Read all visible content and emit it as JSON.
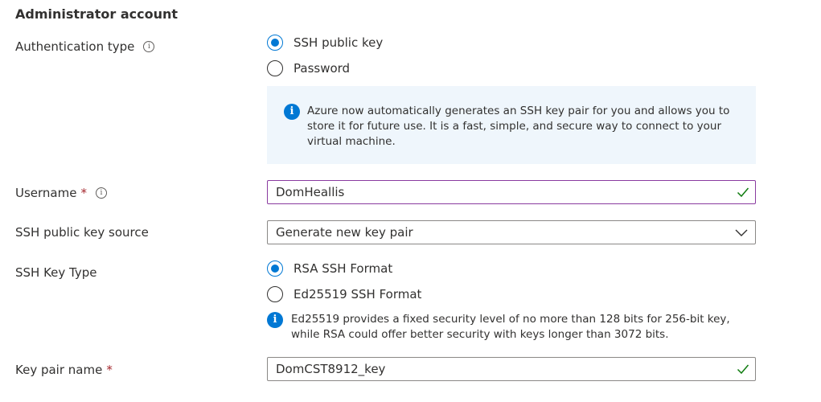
{
  "section_title": "Administrator account",
  "auth_type": {
    "label": "Authentication type",
    "options": [
      "SSH public key",
      "Password"
    ],
    "selected": "SSH public key"
  },
  "callout_text": "Azure now automatically generates an SSH key pair for you and allows you to store it for future use. It is a fast, simple, and secure way to connect to your virtual machine.",
  "username": {
    "label": "Username",
    "required_mark": "*",
    "value": "DomHeallis"
  },
  "key_source": {
    "label": "SSH public key source",
    "value": "Generate new key pair"
  },
  "key_type": {
    "label": "SSH Key Type",
    "options": [
      "RSA SSH Format",
      "Ed25519 SSH Format"
    ],
    "selected": "RSA SSH Format",
    "note": "Ed25519 provides a fixed security level of no more than 128 bits for 256-bit key, while RSA could offer better security with keys longer than 3072 bits."
  },
  "key_pair_name": {
    "label": "Key pair name",
    "required_mark": "*",
    "value": "DomCST8912_key"
  },
  "colors": {
    "accent": "#0078d4",
    "success": "#107c10",
    "required": "#a4262c",
    "callout_bg": "#eff6fc"
  },
  "icons": {
    "info_outline": "info-icon",
    "info_filled": "info-filled-icon",
    "check": "checkmark-icon",
    "dropdown": "chevron-down-icon"
  }
}
